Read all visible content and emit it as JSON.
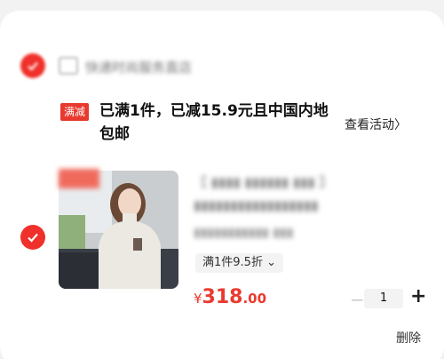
{
  "store": {
    "name": "快递时尚服务直店"
  },
  "promo": {
    "tag": "满减",
    "text": "已满1件，已减15.9元且中国内地包邮",
    "link": "查看活动",
    "link_icon": "chevron-right-icon"
  },
  "item": {
    "badge": "",
    "title_line1": "【 ▮▮▮▮ ▮▮▮▮▮▮ ▮▮▮ 】",
    "title_line2": "▮▮▮▮▮▮▮▮▮▮▮▮▮▮▮▮▮",
    "spec": "▮▮▮▮▮▮▮▮▮▮▮ ▮▮▮",
    "discount_label": "满1件9.5折",
    "discount_icon": "chevron-down-icon",
    "price_currency": "¥",
    "price_integer": "318",
    "price_decimal": ".00",
    "quantity": "1",
    "minus_symbol": "−",
    "plus_symbol": "+",
    "delete_label": "删除"
  },
  "colors": {
    "accent": "#ea3a2f",
    "check": "#f0302a"
  }
}
